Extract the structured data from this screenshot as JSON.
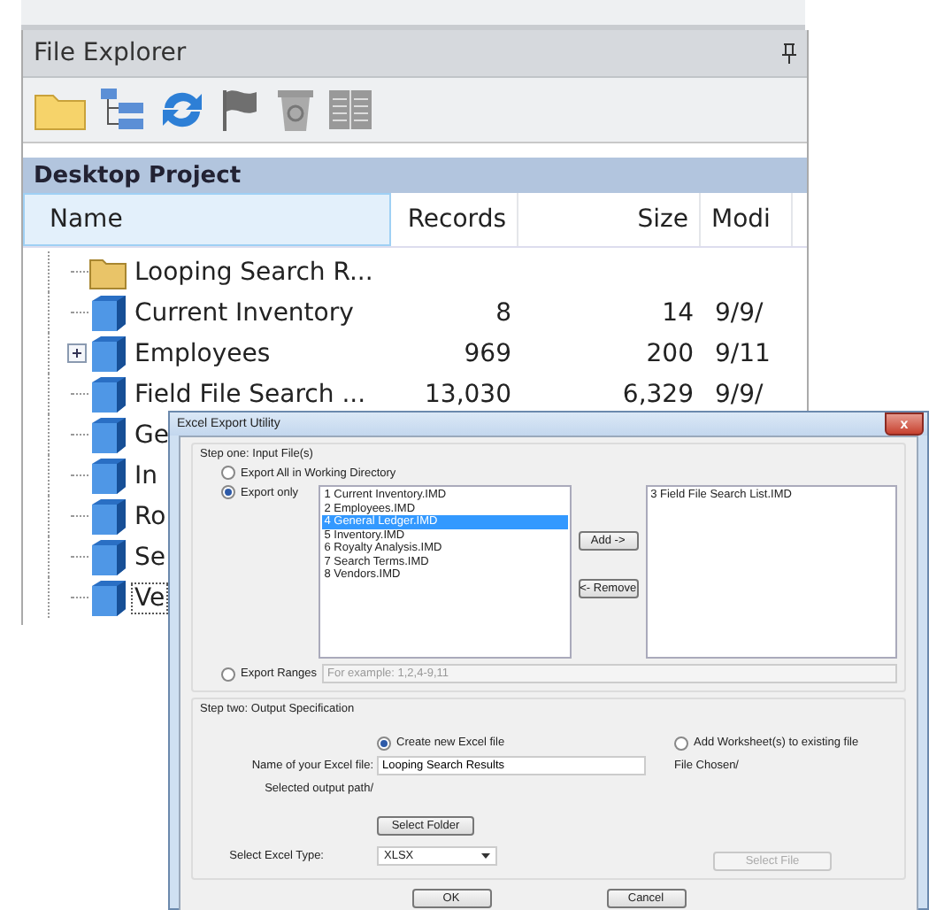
{
  "explorer": {
    "title": "File Explorer",
    "project": "Desktop Project",
    "columns": [
      "Name",
      "Records",
      "Size",
      "Modi"
    ],
    "rows": [
      {
        "kind": "folder",
        "name": "Looping Search R...",
        "records": "",
        "size": "",
        "modified": "",
        "expander": false,
        "focused": false
      },
      {
        "kind": "table",
        "name": "Current Inventory",
        "records": "8",
        "size": "14",
        "modified": "9/9/",
        "expander": false,
        "focused": false
      },
      {
        "kind": "table",
        "name": "Employees",
        "records": "969",
        "size": "200",
        "modified": "9/11",
        "expander": true,
        "focused": false
      },
      {
        "kind": "table",
        "name": "Field File Search ...",
        "records": "13,030",
        "size": "6,329",
        "modified": "9/9/",
        "expander": false,
        "focused": false
      },
      {
        "kind": "table",
        "name": "Ge",
        "records": "",
        "size": "",
        "modified": "",
        "expander": false,
        "focused": false
      },
      {
        "kind": "table",
        "name": "In",
        "records": "",
        "size": "",
        "modified": "",
        "expander": false,
        "focused": false
      },
      {
        "kind": "table",
        "name": "Ro",
        "records": "",
        "size": "",
        "modified": "",
        "expander": false,
        "focused": false
      },
      {
        "kind": "table",
        "name": "Se",
        "records": "",
        "size": "",
        "modified": "",
        "expander": false,
        "focused": false
      },
      {
        "kind": "table",
        "name": "Ve",
        "records": "",
        "size": "",
        "modified": "",
        "expander": false,
        "focused": true
      }
    ]
  },
  "dialog": {
    "title": "Excel Export Utility",
    "close": "x",
    "step_one": {
      "label": "Step one: Input File(s)",
      "options": [
        {
          "label": "Export All in Working Directory",
          "selected": false
        },
        {
          "label": "Export only",
          "selected": true
        }
      ],
      "available_files": [
        {
          "label": "1 Current Inventory.IMD",
          "selected": false
        },
        {
          "label": "2 Employees.IMD",
          "selected": false
        },
        {
          "label": "4 General Ledger.IMD",
          "selected": true
        },
        {
          "label": "5 Inventory.IMD",
          "selected": false
        },
        {
          "label": "6 Royalty Analysis.IMD",
          "selected": false
        },
        {
          "label": "7 Search Terms.IMD",
          "selected": false
        },
        {
          "label": "8 Vendors.IMD",
          "selected": false
        }
      ],
      "add_button": "Add ->",
      "remove_button": "<- Remove",
      "chosen_files": [
        {
          "label": "3 Field File Search List.IMD",
          "selected": false
        }
      ],
      "ranges": {
        "label": "Export Ranges",
        "selected": false,
        "placeholder": "For example: 1,2,4-9,11"
      }
    },
    "step_two": {
      "label": "Step two: Output Specification",
      "create_new": {
        "label": "Create new Excel file",
        "selected": true
      },
      "add_existing": {
        "label": "Add Worksheet(s) to existing file",
        "selected": false
      },
      "name_label": "Name of your Excel file:",
      "name_value": "Looping Search Results",
      "output_path": "Selected output path/",
      "file_chosen": "File Chosen/",
      "select_folder": "Select Folder",
      "type_label": "Select Excel Type:",
      "type_value": "XLSX",
      "select_file": {
        "label": "Select File",
        "disabled": true
      }
    },
    "buttons": [
      "OK",
      "Cancel"
    ]
  }
}
